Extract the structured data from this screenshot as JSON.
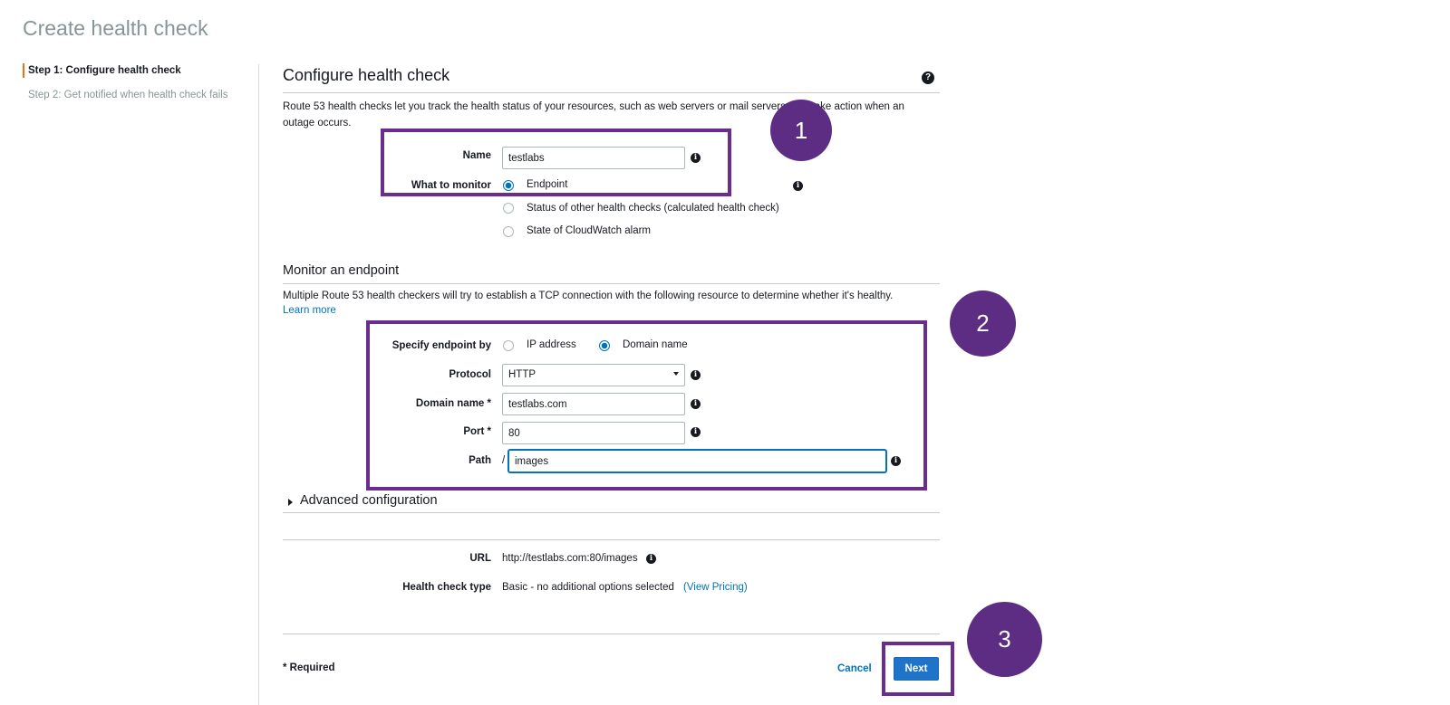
{
  "page": {
    "title": "Create health check"
  },
  "steps": [
    {
      "label": "Step 1: Configure health check",
      "active": true
    },
    {
      "label": "Step 2: Get notified when health check fails",
      "active": false
    }
  ],
  "configure": {
    "heading": "Configure health check",
    "description": "Route 53 health checks let you track the health status of your resources, such as web servers or mail servers, and take action when an outage occurs.",
    "name_label": "Name",
    "name_value": "testlabs",
    "monitor_label": "What to monitor",
    "monitor_options": [
      {
        "label": "Endpoint",
        "checked": true
      },
      {
        "label": "Status of other health checks (calculated health check)",
        "checked": false
      },
      {
        "label": "State of CloudWatch alarm",
        "checked": false
      }
    ]
  },
  "endpoint": {
    "heading": "Monitor an endpoint",
    "description": "Multiple Route 53 health checkers will try to establish a TCP connection with the following resource to determine whether it's healthy.",
    "learn_more": "Learn more",
    "specify_label": "Specify endpoint by",
    "specify_options": [
      {
        "label": "IP address",
        "checked": false
      },
      {
        "label": "Domain name",
        "checked": true
      }
    ],
    "protocol_label": "Protocol",
    "protocol_value": "HTTP",
    "domain_label": "Domain name *",
    "domain_value": "testlabs.com",
    "port_label": "Port *",
    "port_value": "80",
    "path_label": "Path",
    "path_prefix": "/",
    "path_value": "images"
  },
  "advanced": {
    "label": "Advanced configuration"
  },
  "summary": {
    "url_label": "URL",
    "url_value": "http://testlabs.com:80/images",
    "type_label": "Health check type",
    "type_value": "Basic - no additional options selected",
    "pricing_link": "(View Pricing)"
  },
  "footer": {
    "required": "* Required",
    "cancel": "Cancel",
    "next": "Next"
  },
  "annotations": [
    "1",
    "2",
    "3"
  ],
  "icons": {
    "help": "question-circle-icon",
    "info": "info-circle-icon"
  },
  "colors": {
    "annotation": "#5c2d82",
    "primary": "#1f73c9",
    "link": "#0073bb",
    "step_accent": "#ec7211"
  }
}
